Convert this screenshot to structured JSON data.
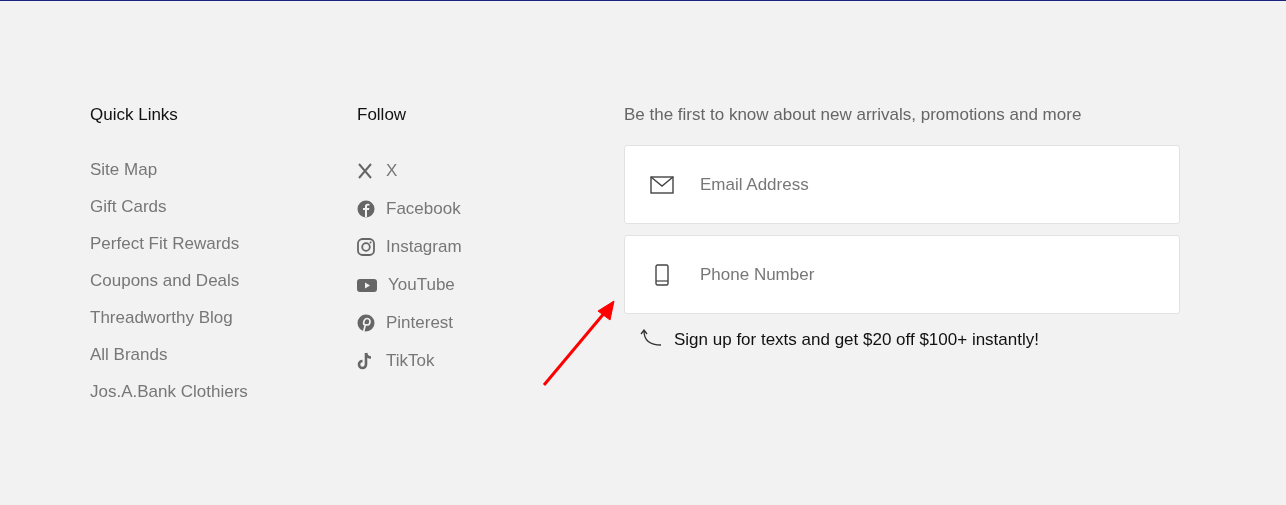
{
  "quick_links": {
    "heading": "Quick Links",
    "items": [
      "Site Map",
      "Gift Cards",
      "Perfect Fit Rewards",
      "Coupons and Deals",
      "Threadworthy Blog",
      "All Brands",
      "Jos.A.Bank Clothiers"
    ]
  },
  "follow": {
    "heading": "Follow",
    "items": [
      {
        "kind": "x",
        "label": "X"
      },
      {
        "kind": "facebook",
        "label": "Facebook"
      },
      {
        "kind": "instagram",
        "label": "Instagram"
      },
      {
        "kind": "youtube",
        "label": "YouTube"
      },
      {
        "kind": "pinterest",
        "label": "Pinterest"
      },
      {
        "kind": "tiktok",
        "label": "TikTok"
      }
    ]
  },
  "signup": {
    "intro": "Be the first to know about new arrivals, promotions and more",
    "fields": [
      {
        "kind": "email",
        "placeholder": "Email Address"
      },
      {
        "kind": "phone",
        "placeholder": "Phone Number"
      }
    ],
    "note": "Sign up for texts and get $20 off $100+ instantly!"
  }
}
